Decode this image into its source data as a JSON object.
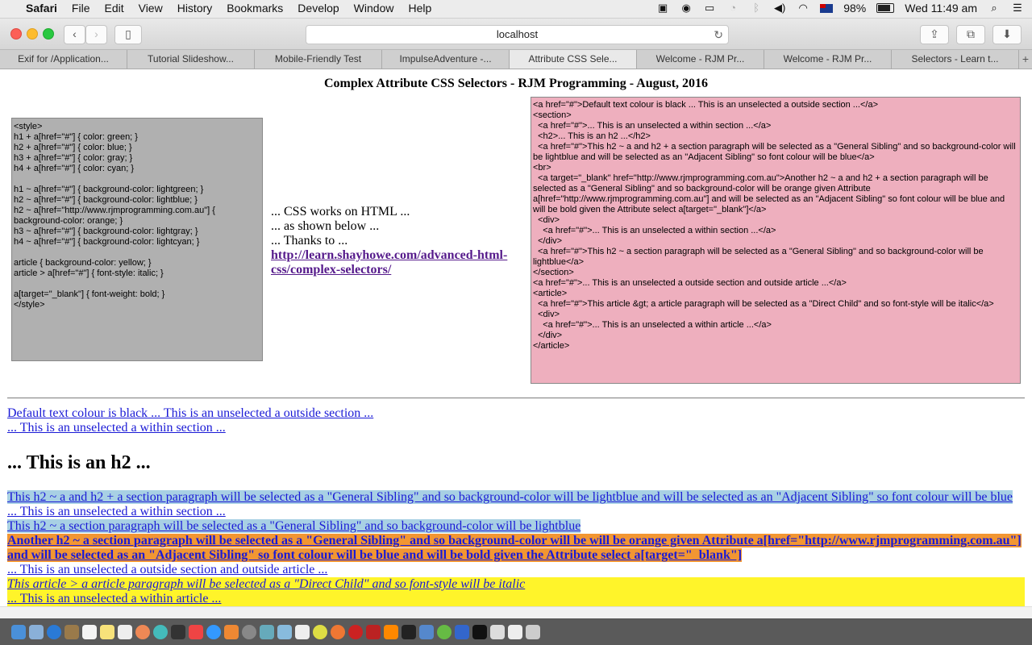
{
  "menubar": {
    "apple": "",
    "app": "Safari",
    "items": [
      "File",
      "Edit",
      "View",
      "History",
      "Bookmarks",
      "Develop",
      "Window",
      "Help"
    ],
    "battery": "98%",
    "clock": "Wed 11:49 am"
  },
  "toolbar": {
    "address": "localhost",
    "back": "‹",
    "forward": "›"
  },
  "tabs": [
    "Exif for /Application...",
    "Tutorial Slideshow...",
    "Mobile-Friendly Test",
    "ImpulseAdventure -...",
    "Attribute CSS Sele...",
    "Welcome - RJM Pr...",
    "Welcome - RJM Pr...",
    "Selectors - Learn t..."
  ],
  "page": {
    "title": "Complex Attribute CSS Selectors - RJM Programming - August, 2016",
    "css_code": "<style>\nh1 + a[href=\"#\"] { color: green; }\nh2 + a[href=\"#\"] { color: blue; }\nh3 + a[href=\"#\"] { color: gray; }\nh4 + a[href=\"#\"] { color: cyan; }\n\nh1 ~ a[href=\"#\"] { background-color: lightgreen; }\nh2 ~ a[href=\"#\"] { background-color: lightblue; }\nh2 ~ a[href=\"http://www.rjmprogramming.com.au\"] {\nbackground-color: orange; }\nh3 ~ a[href=\"#\"] { background-color: lightgray; }\nh4 ~ a[href=\"#\"] { background-color: lightcyan; }\n\narticle { background-color: yellow; }\narticle > a[href=\"#\"] { font-style: italic; }\n\na[target=\"_blank\"] { font-weight: bold; }\n</style>",
    "mid_line1": "... CSS works on HTML ...",
    "mid_line2": "... as shown below ...",
    "mid_line3": "... Thanks to ...",
    "mid_link": "http://learn.shayhowe.com/advanced-html-css/complex-selectors/",
    "html_code": "<a href=\"#\">Default text colour is black ... This is an unselected a outside section ...</a>\n<section>\n  <a href=\"#\">... This is an unselected a within section ...</a>\n  <h2>... This is an h2 ...</h2>\n  <a href=\"#\">This h2 ~ a and h2 + a section paragraph will be selected as a \"General Sibling\" and so background-color will be lightblue and will be selected as an \"Adjacent Sibling\" so font colour will be blue</a>\n<br>\n  <a target=\"_blank\" href=\"http://www.rjmprogramming.com.au\">Another h2 ~ a and h2 + a section paragraph will be selected as a \"General Sibling\" and so background-color will be orange given Attribute a[href=\"http://www.rjmprogramming.com.au\"] and will be selected as an \"Adjacent Sibling\" so font colour will be blue and will be bold given the Attribute select a[target=\"_blank\"]</a>\n  <div>\n    <a href=\"#\">... This is an unselected a within section ...</a>\n  </div>\n  <a href=\"#\">This h2 ~ a section paragraph will be selected as a \"General Sibling\" and so background-color will be lightblue</a>\n</section>\n<a href=\"#\">... This is an unselected a outside section and outside article ...</a>\n<article>\n  <a href=\"#\">This article &gt; a article paragraph will be selected as a \"Direct Child\" and so font-style will be italic</a>\n  <div>\n    <a href=\"#\">... This is an unselected a within article ...</a>\n  </div>\n</article>",
    "demo": {
      "l1": "Default text colour is black ... This is an unselected a outside section ...",
      "l2": "... This is an unselected a within section ...",
      "h2": "... This is an h2 ...",
      "l3": "This h2 ~ a and h2 + a section paragraph will be selected as a \"General Sibling\" and so background-color will be lightblue and will be selected as an \"Adjacent Sibling\" so font colour will be blue",
      "l4": "... This is an unselected a within section ...",
      "l5": "This h2 ~ a section paragraph will be selected as a \"General Sibling\" and so background-color will be lightblue",
      "l6a": "Another h2 ~ a section paragraph will be selected as a \"General Sibling\" and so background-color will be will be orange given Attribute a[href=\"http://www.rjmprogramming.com.au\"]",
      "l6b": "and will be selected as an \"Adjacent Sibling\" so font colour will be blue and will be bold given the Attribute select a[target=\"_blank\"]",
      "l7": "... This is an unselected a outside section and outside article ...",
      "l8": "This article > a article paragraph will be selected as a \"Direct Child\" and so font-style will be italic",
      "l9": "... This is an unselected a within article ..."
    }
  },
  "colors": {
    "css_box": "#b0b0b0",
    "html_box": "#eeafbe",
    "lightblue": "#a8d0e4",
    "orange": "#f29632",
    "yellow": "#fff42a",
    "link": "#1a1ad6"
  }
}
